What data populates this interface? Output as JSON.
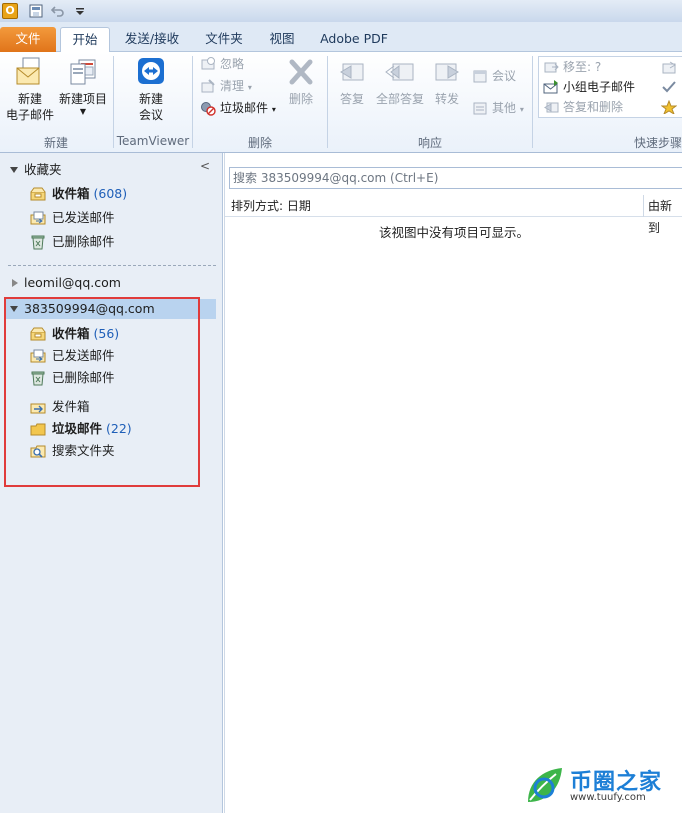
{
  "tabs": [
    {
      "label": "文件"
    },
    {
      "label": "开始"
    },
    {
      "label": "发送/接收"
    },
    {
      "label": "文件夹"
    },
    {
      "label": "视图"
    },
    {
      "label": "Adobe PDF"
    }
  ],
  "ribbon": {
    "new_group": {
      "label": "新建",
      "new_email": "新建\n电子邮件",
      "new_item": "新建项目"
    },
    "teamviewer_group": {
      "label": "TeamViewer",
      "new_meeting": "新建\n会议"
    },
    "delete_group": {
      "label": "删除",
      "ignore": "忽略",
      "clean": "清理",
      "junk": "垃圾邮件",
      "delete": "删除"
    },
    "respond_group": {
      "label": "响应",
      "reply": "答复",
      "reply_all": "全部答复",
      "forward": "转发",
      "meeting": "会议",
      "more": "其他"
    },
    "quick_steps_group": {
      "label": "快速步骤",
      "move_to": "移至: ?",
      "team_email": "小组电子邮件",
      "reply_delete": "答复和删除"
    }
  },
  "nav": {
    "favorites": {
      "header": "收藏夹",
      "folders": [
        {
          "name": "收件箱",
          "count": "(608)"
        },
        {
          "name": "已发送邮件"
        },
        {
          "name": "已删除邮件"
        }
      ]
    },
    "account1": {
      "header": "leomil@qq.com"
    },
    "account2": {
      "header": "383509994@qq.com",
      "folders": [
        {
          "name": "收件箱",
          "count": "(56)"
        },
        {
          "name": "已发送邮件"
        },
        {
          "name": "已删除邮件"
        },
        {
          "name": "发件箱"
        },
        {
          "name": "垃圾邮件",
          "count": "(22)"
        },
        {
          "name": "搜索文件夹"
        }
      ]
    }
  },
  "content": {
    "search_placeholder": "搜索 383509994@qq.com (Ctrl+E)",
    "sort_label": "排列方式: 日期",
    "sort_order": "由新到",
    "empty_message": "该视图中没有项目可显示。"
  },
  "watermark": {
    "title": "币圈之家",
    "url": "www.tuufy.com"
  },
  "colors": {
    "file_tab": "#e0741a",
    "count_blue": "#1f5fb8",
    "highlight_box": "#e03b3b",
    "selected_row": "#b9d3ef"
  }
}
